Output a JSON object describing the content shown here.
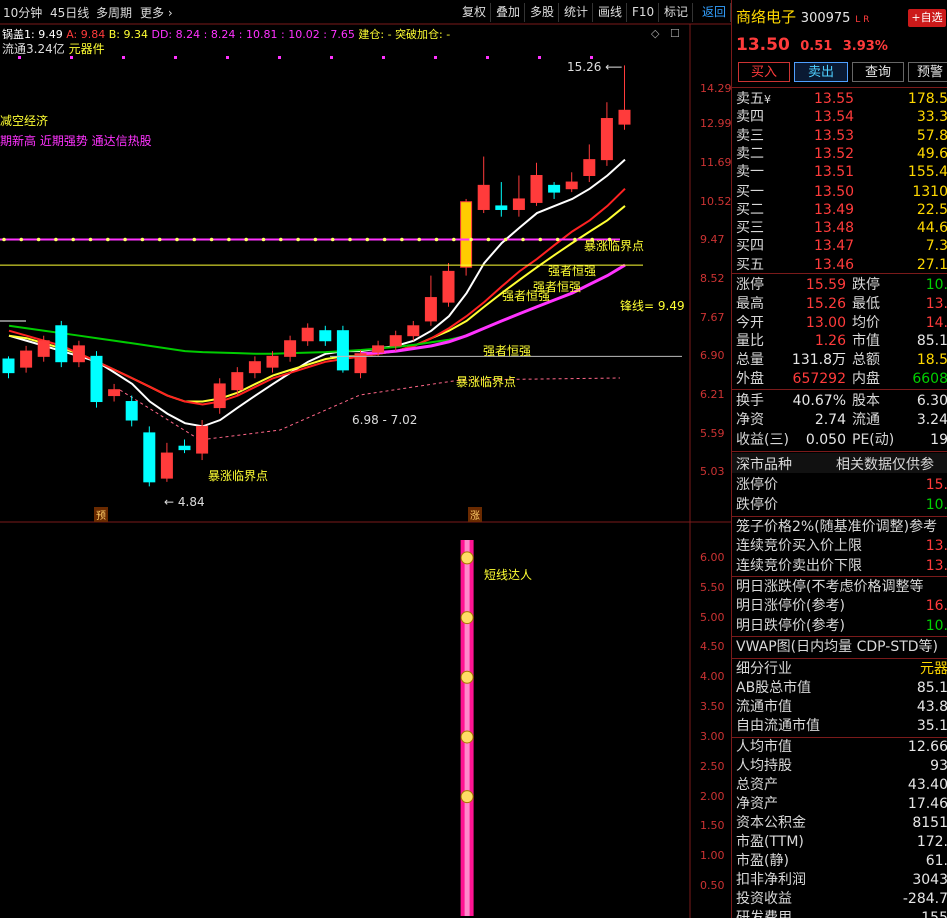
{
  "toolbar": {
    "period": "10分钟",
    "ma_line": "45日线",
    "multi": "多周期",
    "more": "更多",
    "more_icon": "chevron-right-icon",
    "buttons": [
      "复权",
      "叠加",
      "多股",
      "统计",
      "画线",
      "F10",
      "标记",
      "返回"
    ]
  },
  "indicator_bar": {
    "line1": "锅盖1: 9.49",
    "a": "A: 9.84",
    "b": "B: 9.34",
    "dd": "DD: 8.24 : 8.24 : 10.81 : 10.02 : 7.65",
    "jc": "建仓: -",
    "tp": "突破加仓: -",
    "float": "流通3.24亿",
    "sector": "元器件"
  },
  "chart": {
    "left_text1": "减空经济",
    "left_text2": "期新高 近期强势 通达信热股",
    "y_labels": [
      "14.29",
      "12.99",
      "11.69",
      "10.52",
      "9.47",
      "8.52",
      "7.67",
      "6.90",
      "6.21",
      "5.59",
      "5.03"
    ],
    "high_label": "15.26",
    "low_label": "4.84",
    "range_label": "6.98 - 7.02",
    "fengxian": "锋线= 9.49",
    "marker_yu": "预",
    "marker_zhang": "涨",
    "ann_strong": "强者恒强",
    "ann_surge": "暴涨临界点",
    "ann_short": "短线达人",
    "sub_y_labels": [
      "6.00",
      "5.50",
      "5.00",
      "4.50",
      "4.00",
      "3.50",
      "3.00",
      "2.50",
      "2.00",
      "1.50",
      "1.00",
      "0.50"
    ]
  },
  "stock": {
    "name": "商络电子",
    "code": "300975",
    "flags": "L R",
    "add_fav": "+自选",
    "price": "13.50",
    "change": "0.51",
    "pct": "3.93%",
    "btn_buy": "买入",
    "btn_sell": "卖出",
    "btn_query": "查询",
    "btn_warn": "预警"
  },
  "orderbook": [
    {
      "label": "卖五",
      "mark": "¥",
      "price": "13.55",
      "vol": "178.5"
    },
    {
      "label": "卖四",
      "mark": "",
      "price": "13.54",
      "vol": "33.3"
    },
    {
      "label": "卖三",
      "mark": "",
      "price": "13.53",
      "vol": "57.8"
    },
    {
      "label": "卖二",
      "mark": "",
      "price": "13.52",
      "vol": "49.6"
    },
    {
      "label": "卖一",
      "mark": "",
      "price": "13.51",
      "vol": "155.4"
    },
    {
      "label": "买一",
      "mark": "",
      "price": "13.50",
      "vol": "1310"
    },
    {
      "label": "买二",
      "mark": "",
      "price": "13.49",
      "vol": "22.5"
    },
    {
      "label": "买三",
      "mark": "",
      "price": "13.48",
      "vol": "44.6"
    },
    {
      "label": "买四",
      "mark": "",
      "price": "13.47",
      "vol": "7.3"
    },
    {
      "label": "买五",
      "mark": "",
      "price": "13.46",
      "vol": "27.1"
    }
  ],
  "stats": [
    {
      "l1": "涨停",
      "v1": "15.59",
      "c1": "red",
      "l2": "跌停",
      "v2": "10.",
      "c2": "grn"
    },
    {
      "l1": "最高",
      "v1": "15.26",
      "c1": "red",
      "l2": "最低",
      "v2": "13.",
      "c2": "red"
    },
    {
      "l1": "今开",
      "v1": "13.00",
      "c1": "red",
      "l2": "均价",
      "v2": "14.",
      "c2": "red"
    },
    {
      "l1": "量比",
      "v1": "1.26",
      "c1": "red",
      "l2": "市值",
      "v2": "85.1",
      "c2": "wht"
    },
    {
      "l1": "总量",
      "v1": "131.8万",
      "c1": "wht",
      "l2": "总额",
      "v2": "18.5",
      "c2": "yel"
    },
    {
      "l1": "外盘",
      "v1": "657292",
      "c1": "red",
      "l2": "内盘",
      "v2": "6608",
      "c2": "grn"
    }
  ],
  "stats2": [
    {
      "l1": "换手",
      "v1": "40.67%",
      "l2": "股本",
      "v2": "6.30"
    },
    {
      "l1": "净资",
      "v1": "2.74",
      "l2": "流通",
      "v2": "3.24"
    },
    {
      "l1": "收益(三)",
      "v1": "0.050",
      "l2": "PE(动)",
      "v2": "19"
    }
  ],
  "market": {
    "title": "深市品种",
    "note": "相关数据仅供参",
    "up_limit_lbl": "涨停价",
    "up_limit": "15.",
    "down_limit_lbl": "跌停价",
    "down_limit": "10."
  },
  "cage": [
    {
      "label": "笼子价格2%(随基准价调整)参考",
      "value": ""
    },
    {
      "label": "连续竞价买入价上限",
      "value": "13."
    },
    {
      "label": "连续竞价卖出价下限",
      "value": "13."
    }
  ],
  "tomorrow": [
    {
      "label": "明日涨跌停(不考虑价格调整等",
      "value": ""
    },
    {
      "label": "明日涨停价(参考)",
      "value": "16."
    },
    {
      "label": "明日跌停价(参考)",
      "value": "10."
    }
  ],
  "vwap": "VWAP图(日内均量 CDP-STD等)",
  "fundamentals": [
    {
      "label": "细分行业",
      "value": "元器",
      "color": "yel"
    },
    {
      "label": "AB股总市值",
      "value": "85.1",
      "color": "wht"
    },
    {
      "label": "流通市值",
      "value": "43.8",
      "color": "wht"
    },
    {
      "label": "自由流通市值",
      "value": "35.1",
      "color": "wht"
    },
    {
      "label": "人均市值",
      "value": "12.66",
      "color": "wht"
    },
    {
      "label": "人均持股",
      "value": "93",
      "color": "wht"
    },
    {
      "label": "总资产",
      "value": "43.40",
      "color": "wht"
    },
    {
      "label": "净资产",
      "value": "17.46",
      "color": "wht"
    },
    {
      "label": "资本公积金",
      "value": "8151",
      "color": "wht"
    },
    {
      "label": "市盈(TTM)",
      "value": "172.",
      "color": "wht"
    },
    {
      "label": "市盈(静)",
      "value": "61.",
      "color": "wht"
    },
    {
      "label": "扣非净利润",
      "value": "3043",
      "color": "wht"
    },
    {
      "label": "投资收益",
      "value": "-284.7",
      "color": "wht"
    },
    {
      "label": "研发费用",
      "value": "155",
      "color": "wht"
    }
  ],
  "colors": {
    "up": "#ff3b3b",
    "down": "#00ffff",
    "ma5": "#ffffff",
    "ma10": "#ffff33",
    "ma20": "#ff00ff",
    "ma60": "#00cc00",
    "accent_border": "#7a1a1a"
  },
  "chart_data": {
    "type": "candlestick",
    "y_scale": "log",
    "ylim": [
      4.6,
      16.0
    ],
    "candles": [
      {
        "o": 6.85,
        "c": 6.6,
        "h": 6.9,
        "l": 6.5
      },
      {
        "o": 6.7,
        "c": 7.0,
        "h": 7.1,
        "l": 6.6
      },
      {
        "o": 6.9,
        "c": 7.2,
        "h": 7.3,
        "l": 6.8
      },
      {
        "o": 7.5,
        "c": 6.8,
        "h": 7.6,
        "l": 6.7
      },
      {
        "o": 6.8,
        "c": 7.1,
        "h": 7.2,
        "l": 6.7
      },
      {
        "o": 6.9,
        "c": 6.1,
        "h": 7.0,
        "l": 6.0
      },
      {
        "o": 6.2,
        "c": 6.3,
        "h": 6.4,
        "l": 6.1
      },
      {
        "o": 6.1,
        "c": 5.8,
        "h": 6.2,
        "l": 5.7
      },
      {
        "o": 5.6,
        "c": 4.9,
        "h": 5.7,
        "l": 4.84
      },
      {
        "o": 4.95,
        "c": 5.3,
        "h": 5.45,
        "l": 4.9
      },
      {
        "o": 5.4,
        "c": 5.35,
        "h": 5.5,
        "l": 5.3
      },
      {
        "o": 5.3,
        "c": 5.7,
        "h": 5.8,
        "l": 5.2
      },
      {
        "o": 6.0,
        "c": 6.4,
        "h": 6.5,
        "l": 5.9
      },
      {
        "o": 6.3,
        "c": 6.6,
        "h": 6.7,
        "l": 6.2
      },
      {
        "o": 6.6,
        "c": 6.8,
        "h": 6.9,
        "l": 6.5
      },
      {
        "o": 6.7,
        "c": 6.9,
        "h": 7.0,
        "l": 6.6
      },
      {
        "o": 6.9,
        "c": 7.2,
        "h": 7.3,
        "l": 6.8
      },
      {
        "o": 7.2,
        "c": 7.45,
        "h": 7.55,
        "l": 7.1
      },
      {
        "o": 7.4,
        "c": 7.2,
        "h": 7.5,
        "l": 7.1
      },
      {
        "o": 7.4,
        "c": 6.65,
        "h": 7.5,
        "l": 6.6
      },
      {
        "o": 6.6,
        "c": 6.95,
        "h": 7.02,
        "l": 6.5
      },
      {
        "o": 6.98,
        "c": 7.1,
        "h": 7.2,
        "l": 6.9
      },
      {
        "o": 7.1,
        "c": 7.3,
        "h": 7.4,
        "l": 7.0
      },
      {
        "o": 7.3,
        "c": 7.5,
        "h": 7.6,
        "l": 7.2
      },
      {
        "o": 7.6,
        "c": 8.1,
        "h": 8.6,
        "l": 7.5
      },
      {
        "o": 8.0,
        "c": 8.7,
        "h": 8.9,
        "l": 7.9
      },
      {
        "o": 8.8,
        "c": 10.52,
        "h": 10.6,
        "l": 8.6
      },
      {
        "o": 10.3,
        "c": 11.0,
        "h": 11.9,
        "l": 10.2
      },
      {
        "o": 10.4,
        "c": 10.3,
        "h": 11.1,
        "l": 10.1
      },
      {
        "o": 10.3,
        "c": 10.6,
        "h": 11.3,
        "l": 10.1
      },
      {
        "o": 10.5,
        "c": 11.3,
        "h": 11.7,
        "l": 10.4
      },
      {
        "o": 11.0,
        "c": 10.8,
        "h": 11.1,
        "l": 10.6
      },
      {
        "o": 10.9,
        "c": 11.1,
        "h": 11.4,
        "l": 10.8
      },
      {
        "o": 11.3,
        "c": 11.8,
        "h": 12.3,
        "l": 11.1
      },
      {
        "o": 11.8,
        "c": 13.2,
        "h": 13.8,
        "l": 11.6
      },
      {
        "o": 13.0,
        "c": 13.5,
        "h": 15.26,
        "l": 12.8
      }
    ],
    "ma_lines": [
      {
        "name": "white",
        "color": "#ffffff",
        "values": [
          7.3,
          7.2,
          7.1,
          7.0,
          6.9,
          6.8,
          6.6,
          6.4,
          6.1,
          5.9,
          5.75,
          5.7,
          5.8,
          6.0,
          6.2,
          6.4,
          6.6,
          6.8,
          6.95,
          7.0,
          7.0,
          7.05,
          7.1,
          7.2,
          7.4,
          7.7,
          8.2,
          8.9,
          9.4,
          9.8,
          10.2,
          10.4,
          10.6,
          10.9,
          11.3,
          11.8
        ]
      },
      {
        "name": "yellow",
        "color": "#ffff33",
        "values": [
          7.3,
          7.25,
          7.15,
          7.05,
          6.95,
          6.8,
          6.65,
          6.5,
          6.35,
          6.2,
          6.1,
          6.1,
          6.15,
          6.25,
          6.4,
          6.55,
          6.65,
          6.75,
          6.85,
          6.9,
          6.9,
          6.95,
          7.0,
          7.1,
          7.25,
          7.4,
          7.6,
          7.9,
          8.2,
          8.5,
          8.8,
          9.1,
          9.4,
          9.7,
          10.0,
          10.4
        ]
      },
      {
        "name": "red",
        "color": "#ff2222",
        "values": [
          7.4,
          7.3,
          7.2,
          7.1,
          6.95,
          6.8,
          6.65,
          6.5,
          6.35,
          6.2,
          6.1,
          6.05,
          6.1,
          6.2,
          6.35,
          6.5,
          6.6,
          6.7,
          6.8,
          6.85,
          6.9,
          6.95,
          7.0,
          7.1,
          7.25,
          7.45,
          7.7,
          8.0,
          8.35,
          8.7,
          9.0,
          9.35,
          9.7,
          10.0,
          10.4,
          10.9
        ]
      },
      {
        "name": "green",
        "color": "#00cc00",
        "values": [
          7.5,
          7.45,
          7.4,
          7.35,
          7.3,
          7.25,
          7.2,
          7.15,
          7.1,
          7.05,
          7.0,
          6.98,
          6.97,
          6.96,
          6.95,
          6.95,
          6.96,
          6.97,
          6.98,
          7.0,
          7.02,
          7.05,
          7.08,
          7.12,
          7.17,
          7.22,
          7.3,
          null,
          null,
          null,
          null,
          null,
          null,
          null,
          null,
          null
        ]
      },
      {
        "name": "magenta",
        "color": "#ff33ff",
        "values": [
          null,
          null,
          null,
          null,
          null,
          null,
          null,
          null,
          null,
          null,
          null,
          null,
          null,
          null,
          null,
          null,
          null,
          null,
          null,
          null,
          6.95,
          6.97,
          7.0,
          7.05,
          7.1,
          7.18,
          7.3,
          7.45,
          7.6,
          7.75,
          7.9,
          8.05,
          8.2,
          8.4,
          8.6,
          8.85
        ]
      }
    ],
    "levels": [
      {
        "name": "fengxian",
        "value": 9.49,
        "color": "#ff33ff"
      },
      {
        "name": "yellow-level",
        "value": 8.85,
        "color": "#ffff33"
      },
      {
        "name": "white-level",
        "value": 6.9,
        "color": "#bbbbbb"
      }
    ],
    "sub_indicator": {
      "name": "短线达人",
      "ylim": [
        0,
        6.3
      ],
      "bar_index": 26,
      "bar_value": 6.3,
      "markers": [
        6.0,
        5.0,
        4.0,
        3.0,
        2.0
      ]
    }
  }
}
